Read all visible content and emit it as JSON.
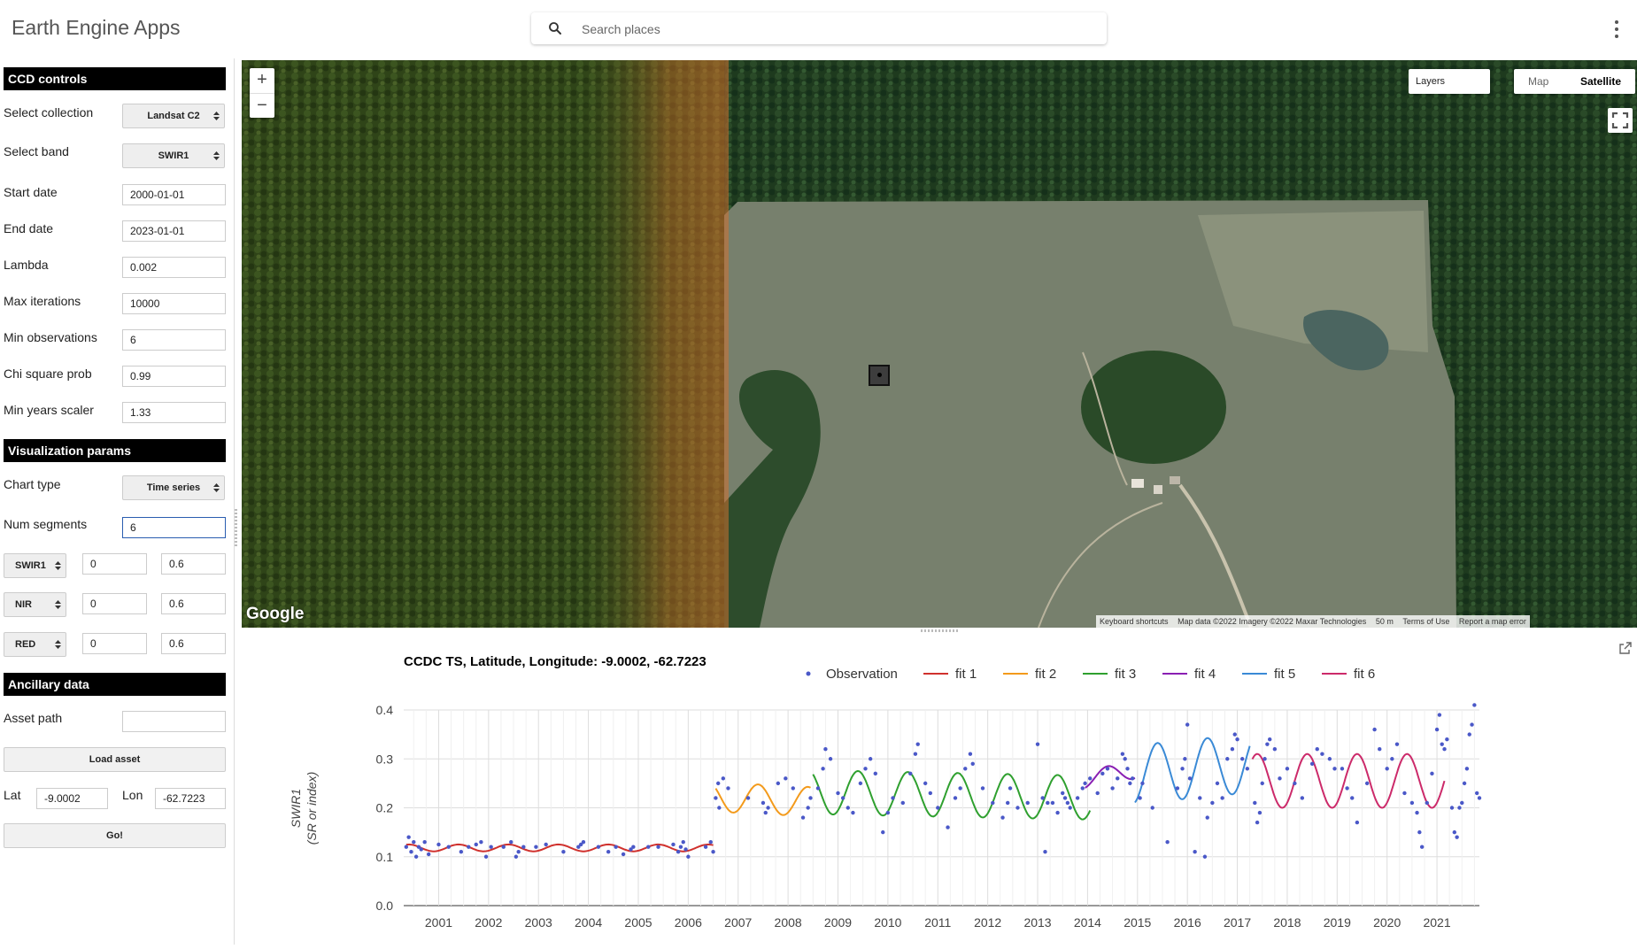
{
  "header": {
    "app_title": "Earth Engine Apps",
    "search_placeholder": "Search places"
  },
  "panel": {
    "ccd_header": "CCD controls",
    "collection_label": "Select collection",
    "collection_value": "Landsat C2",
    "band_label": "Select band",
    "band_value": "SWIR1",
    "start_label": "Start date",
    "start_value": "2000-01-01",
    "end_label": "End date",
    "end_value": "2023-01-01",
    "lambda_label": "Lambda",
    "lambda_value": "0.002",
    "maxiter_label": "Max iterations",
    "maxiter_value": "10000",
    "minobs_label": "Min observations",
    "minobs_value": "6",
    "chisq_label": "Chi square prob",
    "chisq_value": "0.99",
    "minyears_label": "Min years scaler",
    "minyears_value": "1.33",
    "viz_header": "Visualization params",
    "charttype_label": "Chart type",
    "charttype_value": "Time series",
    "numseg_label": "Num segments",
    "numseg_value": "6",
    "rgb": [
      {
        "band": "SWIR1",
        "min": "0",
        "max": "0.6"
      },
      {
        "band": "NIR",
        "min": "0",
        "max": "0.6"
      },
      {
        "band": "RED",
        "min": "0",
        "max": "0.6"
      }
    ],
    "anc_header": "Ancillary data",
    "asset_label": "Asset path",
    "asset_value": "",
    "load_button": "Load asset",
    "lat_label": "Lat",
    "lat_value": "-9.0002",
    "lon_label": "Lon",
    "lon_value": "-62.7223",
    "go_button": "Go!"
  },
  "map": {
    "zoom_in": "+",
    "zoom_out": "−",
    "layers_label": "Layers",
    "maptype_map": "Map",
    "maptype_satellite": "Satellite",
    "google_logo": "Google",
    "attribution": {
      "shortcuts": "Keyboard shortcuts",
      "data": "Map data ©2022 Imagery ©2022 Maxar Technologies",
      "scale": "50 m",
      "terms": "Terms of Use",
      "report": "Report a map error"
    }
  },
  "colors": {
    "obs": "#4a58c8",
    "fit1": "#d0312d",
    "fit2": "#f39a1b",
    "fit3": "#2fa02f",
    "fit4": "#8a1fb3",
    "fit5": "#3a8ad6",
    "fit6": "#cc2a6a"
  },
  "chart_data": {
    "type": "scatter",
    "title": "CCDC TS, Latitude, Longitude: -9.0002, -62.7223",
    "ylabel": "SWIR1",
    "ylabel2": "(SR or index)",
    "ylim": [
      0,
      0.4
    ],
    "yticks": [
      "0.0",
      "0.1",
      "0.2",
      "0.3",
      "0.4"
    ],
    "xlim": [
      2000.3,
      2021.85
    ],
    "xticks": [
      "2001",
      "2002",
      "2003",
      "2004",
      "2005",
      "2006",
      "2007",
      "2008",
      "2009",
      "2010",
      "2011",
      "2012",
      "2013",
      "2014",
      "2015",
      "2016",
      "2017",
      "2018",
      "2019",
      "2020",
      "2021"
    ],
    "legend": [
      "Observation",
      "fit 1",
      "fit 2",
      "fit 3",
      "fit 4",
      "fit 5",
      "fit 6"
    ],
    "fits": [
      {
        "name": "fit 1",
        "start": 2000.35,
        "end": 2006.5,
        "base": 0.118,
        "amp": 0.007,
        "slope": 0
      },
      {
        "name": "fit 2",
        "start": 2006.55,
        "end": 2008.45,
        "base": 0.222,
        "amp": 0.03,
        "slope": -0.005
      },
      {
        "name": "fit 3",
        "start": 2008.5,
        "end": 2014.05,
        "base": 0.232,
        "amp": 0.045,
        "slope": -0.002
      },
      {
        "name": "fit 4",
        "start": 2013.95,
        "end": 2014.95,
        "base": 0.258,
        "amp": 0.018,
        "slope": 0.02
      },
      {
        "name": "fit 5",
        "start": 2014.95,
        "end": 2017.25,
        "base": 0.268,
        "amp": 0.06,
        "slope": 0.01
      },
      {
        "name": "fit 6",
        "start": 2017.3,
        "end": 2021.15,
        "base": 0.255,
        "amp": 0.055,
        "slope": 0
      }
    ],
    "observations": [
      [
        2000.35,
        0.12
      ],
      [
        2000.4,
        0.14
      ],
      [
        2000.45,
        0.11
      ],
      [
        2000.5,
        0.13
      ],
      [
        2000.55,
        0.1
      ],
      [
        2000.6,
        0.12
      ],
      [
        2000.65,
        0.115
      ],
      [
        2000.72,
        0.13
      ],
      [
        2000.8,
        0.105
      ],
      [
        2001.0,
        0.125
      ],
      [
        2001.2,
        0.12
      ],
      [
        2001.45,
        0.11
      ],
      [
        2001.6,
        0.12
      ],
      [
        2001.75,
        0.125
      ],
      [
        2001.85,
        0.13
      ],
      [
        2001.95,
        0.1
      ],
      [
        2002.05,
        0.12
      ],
      [
        2002.3,
        0.12
      ],
      [
        2002.45,
        0.13
      ],
      [
        2002.55,
        0.1
      ],
      [
        2002.6,
        0.11
      ],
      [
        2002.7,
        0.12
      ],
      [
        2002.95,
        0.12
      ],
      [
        2003.15,
        0.125
      ],
      [
        2003.5,
        0.11
      ],
      [
        2003.8,
        0.12
      ],
      [
        2003.85,
        0.125
      ],
      [
        2003.9,
        0.13
      ],
      [
        2004.2,
        0.12
      ],
      [
        2004.4,
        0.11
      ],
      [
        2004.55,
        0.12
      ],
      [
        2004.7,
        0.105
      ],
      [
        2004.85,
        0.115
      ],
      [
        2004.9,
        0.12
      ],
      [
        2005.2,
        0.12
      ],
      [
        2005.4,
        0.12
      ],
      [
        2005.7,
        0.125
      ],
      [
        2005.8,
        0.11
      ],
      [
        2005.85,
        0.12
      ],
      [
        2005.9,
        0.13
      ],
      [
        2005.95,
        0.115
      ],
      [
        2006.0,
        0.1
      ],
      [
        2006.35,
        0.12
      ],
      [
        2006.45,
        0.13
      ],
      [
        2006.5,
        0.11
      ],
      [
        2006.55,
        0.22
      ],
      [
        2006.6,
        0.25
      ],
      [
        2006.62,
        0.2
      ],
      [
        2006.7,
        0.26
      ],
      [
        2006.8,
        0.24
      ],
      [
        2007.2,
        0.22
      ],
      [
        2007.5,
        0.21
      ],
      [
        2007.55,
        0.19
      ],
      [
        2007.6,
        0.2
      ],
      [
        2007.8,
        0.25
      ],
      [
        2007.95,
        0.26
      ],
      [
        2008.1,
        0.24
      ],
      [
        2008.3,
        0.18
      ],
      [
        2008.4,
        0.2
      ],
      [
        2008.45,
        0.22
      ],
      [
        2008.6,
        0.24
      ],
      [
        2008.7,
        0.28
      ],
      [
        2008.75,
        0.32
      ],
      [
        2008.85,
        0.3
      ],
      [
        2009.0,
        0.23
      ],
      [
        2009.1,
        0.22
      ],
      [
        2009.2,
        0.2
      ],
      [
        2009.3,
        0.19
      ],
      [
        2009.45,
        0.25
      ],
      [
        2009.55,
        0.28
      ],
      [
        2009.65,
        0.3
      ],
      [
        2009.75,
        0.27
      ],
      [
        2009.9,
        0.15
      ],
      [
        2010.0,
        0.19
      ],
      [
        2010.1,
        0.22
      ],
      [
        2010.3,
        0.21
      ],
      [
        2010.45,
        0.27
      ],
      [
        2010.55,
        0.31
      ],
      [
        2010.6,
        0.33
      ],
      [
        2010.75,
        0.25
      ],
      [
        2010.85,
        0.23
      ],
      [
        2011.0,
        0.2
      ],
      [
        2011.2,
        0.16
      ],
      [
        2011.35,
        0.22
      ],
      [
        2011.45,
        0.24
      ],
      [
        2011.55,
        0.28
      ],
      [
        2011.65,
        0.31
      ],
      [
        2011.7,
        0.29
      ],
      [
        2011.9,
        0.24
      ],
      [
        2012.1,
        0.21
      ],
      [
        2012.3,
        0.18
      ],
      [
        2012.4,
        0.21
      ],
      [
        2012.45,
        0.24
      ],
      [
        2012.6,
        0.2
      ],
      [
        2012.8,
        0.21
      ],
      [
        2013.0,
        0.33
      ],
      [
        2013.1,
        0.22
      ],
      [
        2013.15,
        0.11
      ],
      [
        2013.2,
        0.21
      ],
      [
        2013.3,
        0.21
      ],
      [
        2013.4,
        0.19
      ],
      [
        2013.5,
        0.23
      ],
      [
        2013.55,
        0.22
      ],
      [
        2013.6,
        0.21
      ],
      [
        2013.65,
        0.2
      ],
      [
        2013.8,
        0.22
      ],
      [
        2013.9,
        0.24
      ],
      [
        2013.95,
        0.25
      ],
      [
        2014.05,
        0.26
      ],
      [
        2014.2,
        0.23
      ],
      [
        2014.3,
        0.27
      ],
      [
        2014.4,
        0.28
      ],
      [
        2014.5,
        0.24
      ],
      [
        2014.6,
        0.26
      ],
      [
        2014.7,
        0.31
      ],
      [
        2014.75,
        0.3
      ],
      [
        2014.8,
        0.28
      ],
      [
        2014.85,
        0.25
      ],
      [
        2014.9,
        0.26
      ],
      [
        2015.05,
        0.22
      ],
      [
        2015.1,
        0.25
      ],
      [
        2015.3,
        0.2
      ],
      [
        2015.6,
        0.13
      ],
      [
        2015.8,
        0.24
      ],
      [
        2015.9,
        0.28
      ],
      [
        2015.95,
        0.3
      ],
      [
        2016.0,
        0.37
      ],
      [
        2016.05,
        0.26
      ],
      [
        2016.15,
        0.11
      ],
      [
        2016.25,
        0.22
      ],
      [
        2016.35,
        0.1
      ],
      [
        2016.4,
        0.18
      ],
      [
        2016.5,
        0.21
      ],
      [
        2016.6,
        0.25
      ],
      [
        2016.7,
        0.22
      ],
      [
        2016.8,
        0.3
      ],
      [
        2016.9,
        0.32
      ],
      [
        2016.95,
        0.35
      ],
      [
        2017.0,
        0.34
      ],
      [
        2017.1,
        0.3
      ],
      [
        2017.2,
        0.28
      ],
      [
        2017.35,
        0.21
      ],
      [
        2017.4,
        0.17
      ],
      [
        2017.45,
        0.19
      ],
      [
        2017.5,
        0.25
      ],
      [
        2017.55,
        0.3
      ],
      [
        2017.6,
        0.33
      ],
      [
        2017.65,
        0.34
      ],
      [
        2017.75,
        0.32
      ],
      [
        2017.85,
        0.26
      ],
      [
        2018.0,
        0.28
      ],
      [
        2018.15,
        0.25
      ],
      [
        2018.3,
        0.22
      ],
      [
        2018.5,
        0.29
      ],
      [
        2018.6,
        0.32
      ],
      [
        2018.7,
        0.31
      ],
      [
        2018.85,
        0.3
      ],
      [
        2018.95,
        0.28
      ],
      [
        2019.1,
        0.28
      ],
      [
        2019.2,
        0.24
      ],
      [
        2019.3,
        0.22
      ],
      [
        2019.4,
        0.17
      ],
      [
        2019.6,
        0.25
      ],
      [
        2019.75,
        0.36
      ],
      [
        2019.85,
        0.32
      ],
      [
        2020.0,
        0.28
      ],
      [
        2020.1,
        0.3
      ],
      [
        2020.2,
        0.33
      ],
      [
        2020.35,
        0.23
      ],
      [
        2020.5,
        0.21
      ],
      [
        2020.6,
        0.19
      ],
      [
        2020.65,
        0.15
      ],
      [
        2020.7,
        0.12
      ],
      [
        2020.8,
        0.21
      ],
      [
        2020.9,
        0.27
      ],
      [
        2021.0,
        0.36
      ],
      [
        2021.05,
        0.39
      ],
      [
        2021.1,
        0.33
      ],
      [
        2021.15,
        0.32
      ],
      [
        2021.2,
        0.34
      ],
      [
        2021.3,
        0.2
      ],
      [
        2021.35,
        0.15
      ],
      [
        2021.4,
        0.14
      ],
      [
        2021.45,
        0.2
      ],
      [
        2021.5,
        0.21
      ],
      [
        2021.55,
        0.25
      ],
      [
        2021.6,
        0.28
      ],
      [
        2021.65,
        0.35
      ],
      [
        2021.7,
        0.37
      ],
      [
        2021.75,
        0.41
      ],
      [
        2021.8,
        0.23
      ],
      [
        2021.85,
        0.22
      ]
    ]
  }
}
